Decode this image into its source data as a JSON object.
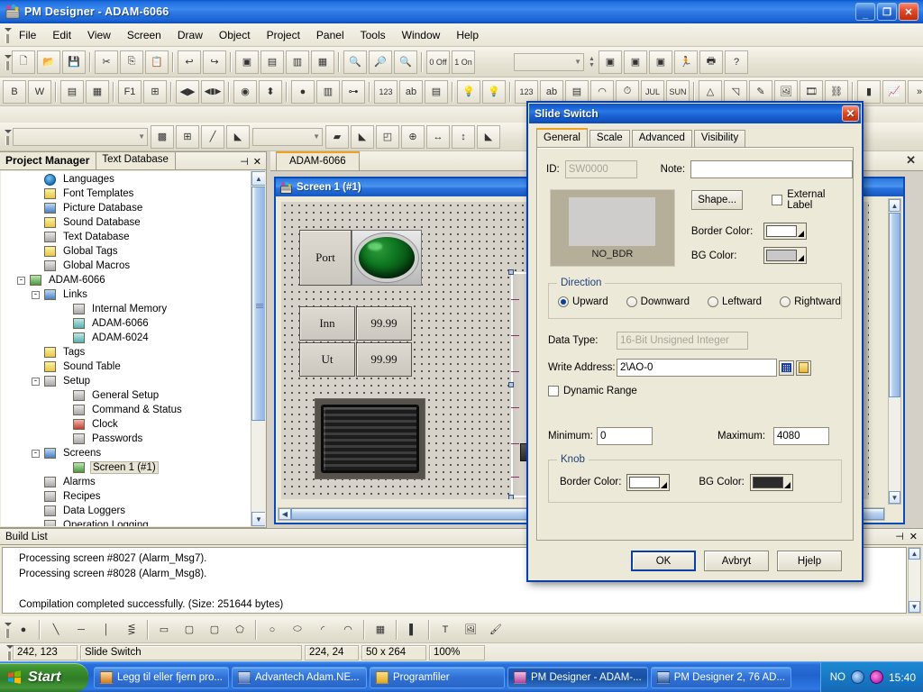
{
  "window": {
    "title": "PM Designer - ADAM-6066",
    "icon": "app-icon",
    "minimize": "_",
    "maximize": "❐",
    "close": "✕"
  },
  "menu": [
    "File",
    "Edit",
    "View",
    "Screen",
    "Draw",
    "Object",
    "Project",
    "Panel",
    "Tools",
    "Window",
    "Help"
  ],
  "toolbar1": [
    {
      "name": "new-file-icon",
      "glyph": "🗋"
    },
    {
      "name": "open-file-icon",
      "glyph": "📂"
    },
    {
      "name": "save-icon",
      "glyph": "💾"
    },
    {
      "sep": true
    },
    {
      "name": "cut-icon",
      "glyph": "✂"
    },
    {
      "name": "copy-icon",
      "glyph": "⎘"
    },
    {
      "name": "paste-icon",
      "glyph": "📋"
    },
    {
      "sep": true
    },
    {
      "name": "undo-icon",
      "glyph": "↩"
    },
    {
      "name": "redo-icon",
      "glyph": "↪"
    },
    {
      "sep": true
    },
    {
      "name": "new-screen-icon",
      "glyph": "▣"
    },
    {
      "name": "screen-properties-icon",
      "glyph": "▤"
    },
    {
      "name": "open-screen-icon",
      "glyph": "▥"
    },
    {
      "name": "close-screen-icon",
      "glyph": "▦"
    },
    {
      "sep": true
    },
    {
      "name": "zoom-in-icon",
      "glyph": "🔍"
    },
    {
      "name": "zoom-out-icon",
      "glyph": "🔎"
    },
    {
      "name": "zoom-fit-icon",
      "glyph": "🔍"
    },
    {
      "sep": true
    },
    {
      "name": "state-off-icon",
      "glyph": "0 Off"
    },
    {
      "name": "state-on-icon",
      "glyph": "1 On"
    }
  ],
  "toolbar1_right": {
    "combo_value": "",
    "buttons": [
      {
        "name": "compile-icon",
        "glyph": "▣"
      },
      {
        "name": "download-icon",
        "glyph": "▣"
      },
      {
        "name": "edit-project-icon",
        "glyph": "▣"
      },
      {
        "name": "run-simulation-icon",
        "glyph": "🏃"
      },
      {
        "name": "print-icon",
        "glyph": "🖶"
      },
      {
        "name": "help-icon",
        "glyph": "?"
      }
    ]
  },
  "toolbar2": [
    {
      "name": "bit-button-icon",
      "glyph": "B"
    },
    {
      "name": "word-button-icon",
      "glyph": "W"
    },
    {
      "sep": true
    },
    {
      "name": "screen-button-icon",
      "glyph": "▤"
    },
    {
      "name": "calendar-icon",
      "glyph": "▦"
    },
    {
      "sep": true
    },
    {
      "name": "function-key-icon",
      "glyph": "F1"
    },
    {
      "name": "keypad-icon",
      "glyph": "⊞"
    },
    {
      "sep": true
    },
    {
      "name": "step-buttons-icon",
      "glyph": "◀▶"
    },
    {
      "name": "multi-step-icon",
      "glyph": "◀▮▶"
    },
    {
      "sep": true
    },
    {
      "name": "radio-indicator-icon",
      "glyph": "◉"
    },
    {
      "name": "updown-icon",
      "glyph": "⬍"
    },
    {
      "sep": true
    },
    {
      "name": "on-off-lamp-icon",
      "glyph": "●"
    },
    {
      "name": "multistate-lamp-icon",
      "glyph": "▥"
    },
    {
      "name": "pipe-icon",
      "glyph": "⊶"
    },
    {
      "sep": true
    },
    {
      "name": "numeric-entry-icon",
      "glyph": "123"
    },
    {
      "name": "ascii-entry-icon",
      "glyph": "ab"
    },
    {
      "name": "text-display-icon",
      "glyph": "▤"
    },
    {
      "sep": true
    },
    {
      "name": "lamp-icon",
      "glyph": "💡"
    },
    {
      "name": "indicator-lamp-icon",
      "glyph": "💡"
    },
    {
      "sep": true
    },
    {
      "name": "numeric-display-icon",
      "glyph": "123"
    },
    {
      "name": "ascii-display-icon",
      "glyph": "ab"
    },
    {
      "name": "message-display-icon",
      "glyph": "▤"
    },
    {
      "name": "meter-icon",
      "glyph": "◠"
    },
    {
      "name": "clock-display-icon",
      "glyph": "⏱"
    },
    {
      "name": "date-display-icon",
      "glyph": "JUL"
    },
    {
      "name": "day-display-icon",
      "glyph": "SUN"
    },
    {
      "sep": true
    },
    {
      "name": "compass-tool-icon",
      "glyph": "△"
    },
    {
      "name": "select-area-icon",
      "glyph": "◹"
    },
    {
      "name": "magic-wand-icon",
      "glyph": "✎"
    },
    {
      "name": "picture-icon",
      "glyph": "🖼"
    },
    {
      "name": "animation-icon",
      "glyph": "🎞"
    },
    {
      "name": "link-object-icon",
      "glyph": "⛓"
    },
    {
      "sep": true
    },
    {
      "name": "bar-graph-icon",
      "glyph": "▮"
    },
    {
      "name": "trend-graph-icon",
      "glyph": "📈"
    },
    {
      "name": "toolbar-overflow-icon",
      "glyph": "»"
    }
  ],
  "toolbar4": {
    "font_combo": "",
    "size_combo": "",
    "buttons": [
      {
        "name": "fill-pattern-icon",
        "glyph": "▩"
      },
      {
        "name": "grid-icon",
        "glyph": "⊞"
      },
      {
        "name": "line-style-icon",
        "glyph": "╱"
      },
      {
        "name": "line-color-icon",
        "glyph": "◣"
      },
      {
        "name": "fill-style-icon",
        "glyph": "▰"
      },
      {
        "name": "fill-color-icon",
        "glyph": "◣"
      },
      {
        "name": "bring-to-front-icon",
        "glyph": "◰"
      },
      {
        "name": "align-center-icon",
        "glyph": "⊕"
      },
      {
        "name": "align-horizontal-icon",
        "glyph": "↔"
      },
      {
        "name": "align-vertical-icon",
        "glyph": "↕"
      },
      {
        "name": "text-color-icon",
        "glyph": "◣"
      }
    ]
  },
  "drawbar": [
    {
      "name": "point-tool-icon",
      "glyph": "●"
    },
    {
      "sep": true
    },
    {
      "name": "line-tool-icon",
      "glyph": "╲"
    },
    {
      "name": "horizontal-line-tool-icon",
      "glyph": "─"
    },
    {
      "name": "vertical-line-tool-icon",
      "glyph": "│"
    },
    {
      "name": "polyline-tool-icon",
      "glyph": "⋚"
    },
    {
      "sep": true
    },
    {
      "name": "rectangle-tool-icon",
      "glyph": "▭"
    },
    {
      "name": "rounded-rect-tool-icon",
      "glyph": "▢"
    },
    {
      "name": "rounded-rect2-tool-icon",
      "glyph": "▢"
    },
    {
      "name": "polygon-tool-icon",
      "glyph": "⬠"
    },
    {
      "sep": true
    },
    {
      "name": "circle-tool-icon",
      "glyph": "○"
    },
    {
      "name": "ellipse-tool-icon",
      "glyph": "⬭"
    },
    {
      "name": "arc-tool-icon",
      "glyph": "◜"
    },
    {
      "name": "pie-tool-icon",
      "glyph": "◠"
    },
    {
      "sep": true
    },
    {
      "name": "table-tool-icon",
      "glyph": "▦"
    },
    {
      "sep": true
    },
    {
      "name": "scale-tool-icon",
      "glyph": "▌"
    },
    {
      "sep": true
    },
    {
      "name": "text-tool-icon",
      "glyph": "T"
    },
    {
      "name": "picture-tool-icon",
      "glyph": "🖼"
    },
    {
      "name": "brush-tool-icon",
      "glyph": "🖌"
    }
  ],
  "project_manager": {
    "tabs": [
      {
        "label": "Project Manager",
        "active": true
      },
      {
        "label": "Text Database",
        "active": false
      }
    ],
    "pin": "⊣",
    "close": "✕",
    "tree": [
      {
        "label": "Languages",
        "indent": 3,
        "icon": "globe-icon",
        "expander": null,
        "selected": false
      },
      {
        "label": "Font Templates",
        "indent": 3,
        "icon": "font-templates-icon",
        "expander": null,
        "selected": false
      },
      {
        "label": "Picture Database",
        "indent": 3,
        "icon": "picture-database-icon",
        "expander": null,
        "selected": false
      },
      {
        "label": "Sound Database",
        "indent": 3,
        "icon": "sound-database-icon",
        "expander": null,
        "selected": false
      },
      {
        "label": "Text Database",
        "indent": 3,
        "icon": "text-database-icon",
        "expander": null,
        "selected": false
      },
      {
        "label": "Global Tags",
        "indent": 3,
        "icon": "global-tags-icon",
        "expander": null,
        "selected": false
      },
      {
        "label": "Global Macros",
        "indent": 3,
        "icon": "global-macros-icon",
        "expander": null,
        "selected": false
      },
      {
        "label": "ADAM-6066",
        "indent": 2,
        "icon": "device-icon",
        "expander": "-",
        "selected": false
      },
      {
        "label": "Links",
        "indent": 3,
        "icon": "links-icon",
        "expander": "-",
        "selected": false
      },
      {
        "label": "Internal Memory",
        "indent": 5,
        "icon": "memory-icon",
        "expander": null,
        "selected": false
      },
      {
        "label": "ADAM-6066",
        "indent": 5,
        "icon": "link-node-icon",
        "expander": null,
        "selected": false
      },
      {
        "label": "ADAM-6024",
        "indent": 5,
        "icon": "link-node-icon",
        "expander": null,
        "selected": false
      },
      {
        "label": "Tags",
        "indent": 3,
        "icon": "tags-icon",
        "expander": null,
        "selected": false
      },
      {
        "label": "Sound Table",
        "indent": 3,
        "icon": "sound-table-icon",
        "expander": null,
        "selected": false
      },
      {
        "label": "Setup",
        "indent": 3,
        "icon": "setup-icon",
        "expander": "-",
        "selected": false
      },
      {
        "label": "General Setup",
        "indent": 5,
        "icon": "general-setup-icon",
        "expander": null,
        "selected": false
      },
      {
        "label": "Command & Status",
        "indent": 5,
        "icon": "command-status-icon",
        "expander": null,
        "selected": false
      },
      {
        "label": "Clock",
        "indent": 5,
        "icon": "clock-icon",
        "expander": null,
        "selected": false
      },
      {
        "label": "Passwords",
        "indent": 5,
        "icon": "passwords-icon",
        "expander": null,
        "selected": false
      },
      {
        "label": "Screens",
        "indent": 3,
        "icon": "screens-icon",
        "expander": "-",
        "selected": false
      },
      {
        "label": "Screen 1 (#1)",
        "indent": 5,
        "icon": "screen-icon",
        "expander": null,
        "selected": true
      },
      {
        "label": "Alarms",
        "indent": 3,
        "icon": "alarms-icon",
        "expander": null,
        "selected": false
      },
      {
        "label": "Recipes",
        "indent": 3,
        "icon": "recipes-icon",
        "expander": null,
        "selected": false
      },
      {
        "label": "Data Loggers",
        "indent": 3,
        "icon": "data-loggers-icon",
        "expander": null,
        "selected": false
      },
      {
        "label": "Operation Logging",
        "indent": 3,
        "icon": "operation-logging-icon",
        "expander": null,
        "selected": false
      }
    ]
  },
  "editor": {
    "doc_tab": "ADAM-6066",
    "close": "✕",
    "mdi_title": "Screen 1 (#1)",
    "objects": {
      "label_port": "Port",
      "label_inn": "Inn",
      "value_inn": "99.99",
      "label_ut": "Ut",
      "value_ut": "99.99"
    }
  },
  "build": {
    "title": "Build List",
    "pin": "⊣",
    "close": "✕",
    "lines": [
      "Processing screen #8027 (Alarm_Msg7).",
      "Processing screen #8028 (Alarm_Msg8).",
      "",
      "Compilation completed successfully. (Size: 251644 bytes)"
    ]
  },
  "statusbar": {
    "cursor": "242, 123",
    "object": "Slide Switch",
    "position": "224, 24",
    "size": "50 x 264",
    "zoom": "100%"
  },
  "taskbar": {
    "start": "Start",
    "tasks": [
      {
        "label": "Legg til eller fjern pro...",
        "icon": "add-remove-programs-icon",
        "active": false
      },
      {
        "label": "Advantech Adam.NE...",
        "icon": "advantech-icon",
        "active": false
      },
      {
        "label": "Programfiler",
        "icon": "folder-icon",
        "active": false
      },
      {
        "label": "PM Designer - ADAM-...",
        "icon": "pm-designer-icon",
        "active": true
      },
      {
        "label": "PM Designer 2, 76 AD...",
        "icon": "word-document-icon",
        "active": false
      }
    ],
    "tray": {
      "language": "NO",
      "icons": [
        "volume-icon",
        "antivirus-icon"
      ],
      "clock": "15:40"
    }
  },
  "dialog": {
    "title": "Slide Switch",
    "close": "✕",
    "tabs": [
      {
        "label": "General",
        "active": true
      },
      {
        "label": "Scale",
        "active": false
      },
      {
        "label": "Advanced",
        "active": false
      },
      {
        "label": "Visibility",
        "active": false
      }
    ],
    "id_label": "ID:",
    "id_value": "SW0000",
    "note_label": "Note:",
    "note_value": "",
    "preview_caption": "NO_BDR",
    "shape_button": "Shape...",
    "external_label": "External Label",
    "external_label_checked": false,
    "border_color_label": "Border Color:",
    "border_color_value": "#ffffff",
    "bg_color_label": "BG Color:",
    "bg_color_value": "#c8c8c8",
    "direction": {
      "caption": "Direction",
      "options": [
        "Upward",
        "Downward",
        "Leftward",
        "Rightward"
      ],
      "selected": "Upward"
    },
    "data_type_label": "Data Type:",
    "data_type_value": "16-Bit Unsigned Integer",
    "write_address_label": "Write Address:",
    "write_address_value": "2\\AO-0",
    "address_buttons": [
      "keypad-icon",
      "tag-icon"
    ],
    "dynamic_range_label": "Dynamic Range",
    "dynamic_range_checked": false,
    "minimum_label": "Minimum:",
    "minimum_value": "0",
    "maximum_label": "Maximum:",
    "maximum_value": "4080",
    "knob": {
      "caption": "Knob",
      "border_color_label": "Border Color:",
      "border_color_value": "#ffffff",
      "bg_color_label": "BG Color:",
      "bg_color_value": "#2b2b2b"
    },
    "buttons": {
      "ok": "OK",
      "cancel": "Avbryt",
      "help": "Hjelp"
    }
  }
}
